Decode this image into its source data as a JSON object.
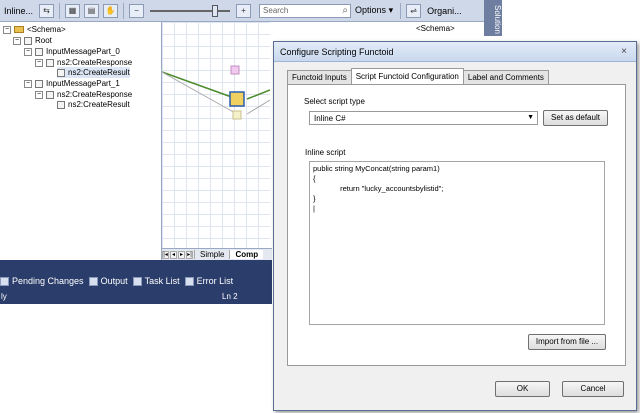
{
  "toolbar": {
    "doc_title": "Inline...",
    "zoom_minus": "−",
    "zoom_plus": "+",
    "search_placeholder": "Search",
    "options_label": "Options",
    "organize_label": "Organi..."
  },
  "solution_tab": "Solution",
  "tree": {
    "schema_label": "<Schema>",
    "root_label": "Root",
    "part0_label": "InputMessagePart_0",
    "part0_response": "ns2:CreateResponse",
    "part0_result": "ns2:CreateResult",
    "part1_label": "InputMessagePart_1",
    "part1_response": "ns2:CreateResponse",
    "part1_result": "ns2:CreateResult"
  },
  "right_schema_label": "<Schema>",
  "grid_tabs": {
    "simple": "Simple",
    "comp": "Comp"
  },
  "bottom_tabs": {
    "pending": "Pending Changes",
    "output": "Output",
    "tasks": "Task List",
    "errors": "Error List"
  },
  "status": {
    "left": "ly",
    "line": "Ln 2"
  },
  "dialog": {
    "title": "Configure Scripting Functoid",
    "close_glyph": "×",
    "tabs": [
      "Functoid Inputs",
      "Script Functoid Configuration",
      "Label and Comments"
    ],
    "select_label": "Select script type",
    "script_type": "Inline C#",
    "set_default_label": "Set as default",
    "inline_label": "Inline script",
    "code": "public string MyConcat(string param1)\n{\n             return \"lucky_accountsbylistid\";\n}\n|",
    "import_label": "Import from file ...",
    "ok_label": "OK",
    "cancel_label": "Cancel"
  },
  "colors": {
    "accent": "#2b3d6b",
    "dialog_bg": "#f0f0f0"
  }
}
